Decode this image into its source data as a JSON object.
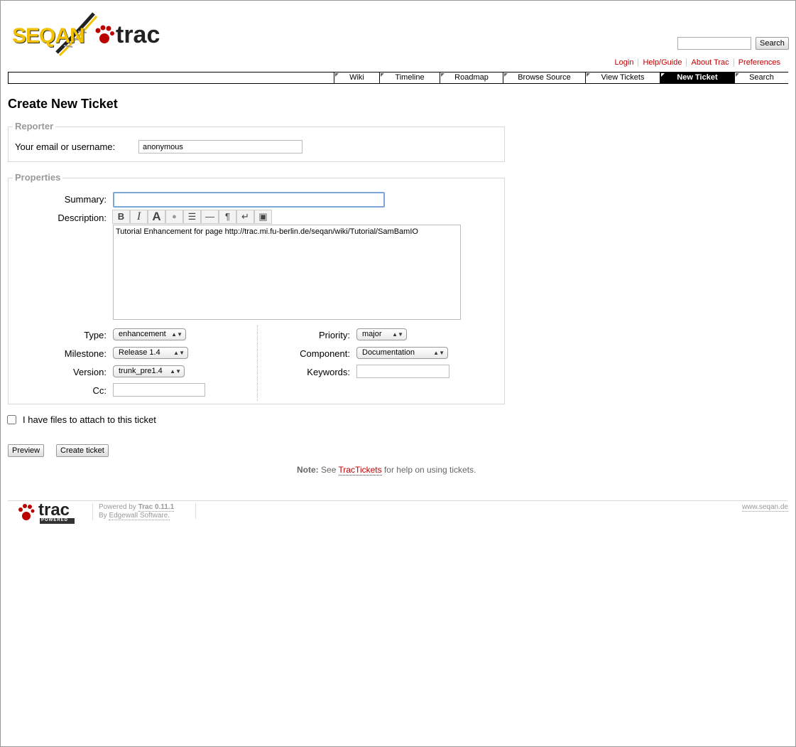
{
  "header": {
    "logo_text_left": "SEQAN",
    "logo_text_right": "trac",
    "search_button": "Search",
    "metanav": [
      "Login",
      "Help/Guide",
      "About Trac",
      "Preferences"
    ]
  },
  "mainnav": {
    "tabs": [
      "Wiki",
      "Timeline",
      "Roadmap",
      "Browse Source",
      "View Tickets",
      "New Ticket",
      "Search"
    ],
    "active": "New Ticket"
  },
  "page": {
    "title": "Create New Ticket"
  },
  "reporter": {
    "legend": "Reporter",
    "label": "Your email or username:",
    "value": "anonymous"
  },
  "properties": {
    "legend": "Properties",
    "summary_label": "Summary:",
    "summary_value": "",
    "description_label": "Description:",
    "description_value": "Tutorial Enhancement for page http://trac.mi.fu-berlin.de/seqan/wiki/Tutorial/SamBamIO",
    "toolbar": [
      "B",
      "I",
      "A",
      "●",
      "☰",
      "—",
      "¶",
      "↵",
      "▣"
    ],
    "type_label": "Type:",
    "type_value": "enhancement",
    "milestone_label": "Milestone:",
    "milestone_value": "Release 1.4",
    "version_label": "Version:",
    "version_value": "trunk_pre1.4",
    "cc_label": "Cc:",
    "cc_value": "",
    "priority_label": "Priority:",
    "priority_value": "major",
    "component_label": "Component:",
    "component_value": "Documentation",
    "keywords_label": "Keywords:",
    "keywords_value": ""
  },
  "attach": {
    "label": "I have files to attach to this ticket",
    "checked": false
  },
  "buttons": {
    "preview": "Preview",
    "create": "Create ticket"
  },
  "note": {
    "prefix": "Note:",
    "text1": "See",
    "link": "TracTickets",
    "text2": "for help on using tickets."
  },
  "footer": {
    "powered_by": "Powered by",
    "trac_version": "Trac 0.11.1",
    "by": "By",
    "edgewall": "Edgewall Software.",
    "site": "www.seqan.de",
    "logo_text": "trac",
    "logo_sub": "POWERED"
  },
  "colors": {
    "link": "#bb0000",
    "active_tab": "#000000",
    "logo_yellow": "#f2c200"
  }
}
